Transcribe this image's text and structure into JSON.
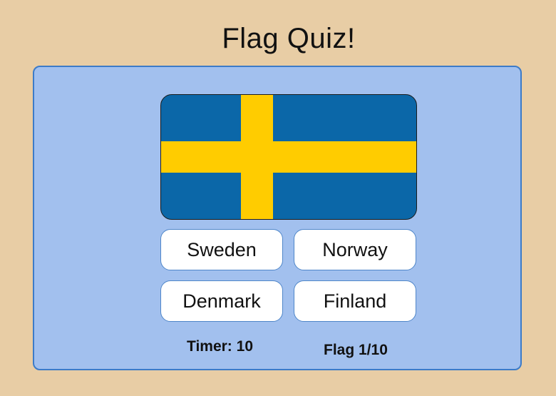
{
  "title": "Flag Quiz!",
  "flag": {
    "country_icon": "sweden-flag-icon",
    "colors": {
      "field": "#0B67A8",
      "cross": "#FFCC00"
    }
  },
  "answers": [
    {
      "label": "Sweden"
    },
    {
      "label": "Norway"
    },
    {
      "label": "Denmark"
    },
    {
      "label": "Finland"
    }
  ],
  "status": {
    "timer": "Timer: 10",
    "progress": "Flag 1/10"
  },
  "colors": {
    "background": "#E8CDA5",
    "panel": "#A2C0EE",
    "panel_border": "#3C7BC8",
    "button": "#FFFFFF"
  }
}
